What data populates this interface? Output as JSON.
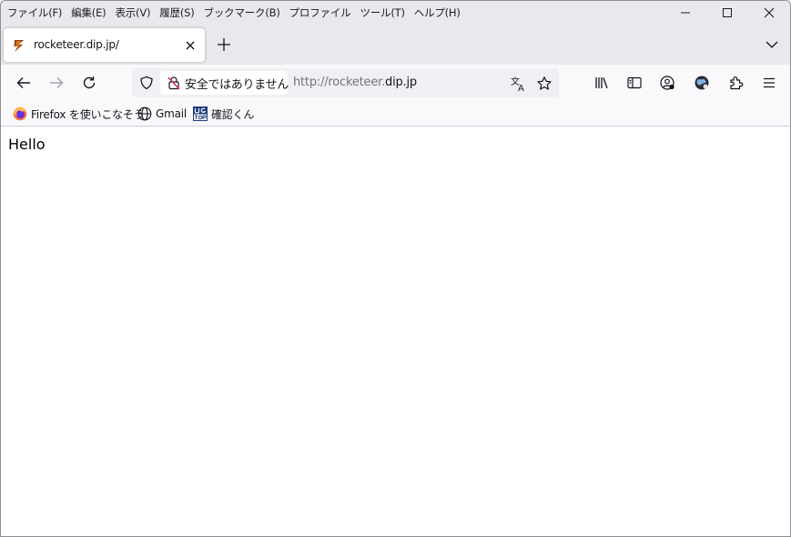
{
  "menu": [
    "ファイル(F)",
    "編集(E)",
    "表示(V)",
    "履歴(S)",
    "ブックマーク(B)",
    "プロファイル",
    "ツール(T)",
    "ヘルプ(H)"
  ],
  "tab": {
    "title": "rocketeer.dip.jp/"
  },
  "urlbar": {
    "insecure_label": "安全ではありません",
    "url_prefix": "http://rocketeer.",
    "url_host": "dip.jp"
  },
  "bookmarks": [
    {
      "label": "Firefox を使いこなそう",
      "icon": "firefox-icon"
    },
    {
      "label": "Gmail",
      "icon": "globe-icon"
    },
    {
      "label": "確認くん",
      "icon": "ug-top-icon"
    }
  ],
  "page": {
    "text": "Hello"
  },
  "colors": {
    "chrome": "#e9e9ed",
    "toolbar": "#f9f9fb",
    "urlbar": "#f0f0f4",
    "insecure_icon": "#e22850"
  }
}
